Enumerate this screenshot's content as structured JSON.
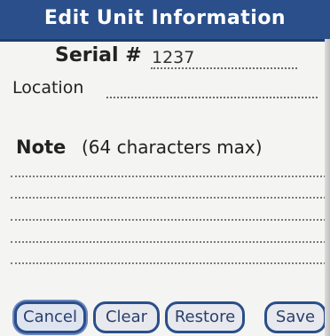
{
  "header": {
    "title": "Edit Unit Information"
  },
  "fields": {
    "serial": {
      "label": "Serial #",
      "value": "1237"
    },
    "location": {
      "label": "Location",
      "value": ""
    },
    "note": {
      "label": "Note",
      "hint": "(64 characters max)",
      "value": ""
    }
  },
  "buttons": {
    "cancel": "Cancel",
    "clear": "Clear",
    "restore": "Restore",
    "save": "Save"
  },
  "colors": {
    "title_bar": "#2a4f8a",
    "button_border": "#2a4f8a",
    "background": "#f4f4f2"
  }
}
